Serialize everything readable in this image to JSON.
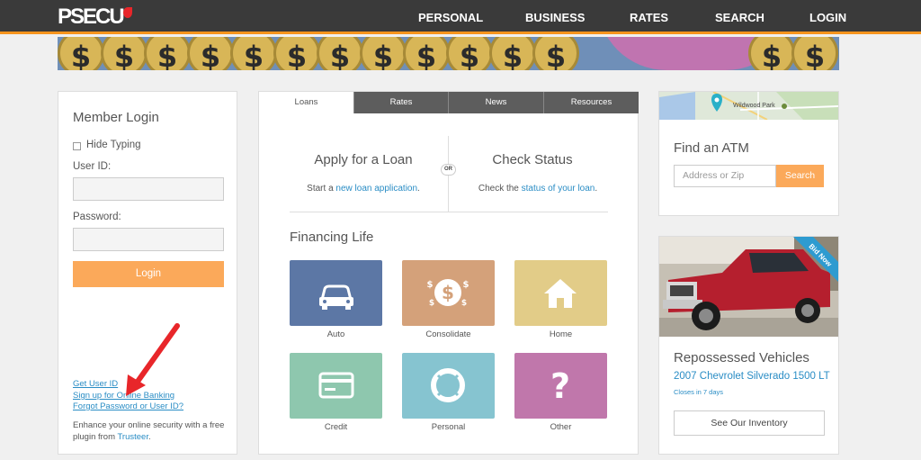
{
  "header": {
    "logo": "PSECU",
    "nav": [
      "PERSONAL",
      "BUSINESS",
      "RATES",
      "SEARCH",
      "LOGIN"
    ]
  },
  "login": {
    "title": "Member Login",
    "hide_typing": "Hide Typing",
    "user_id_label": "User ID:",
    "password_label": "Password:",
    "login_button": "Login",
    "links": [
      "Get User ID",
      "Sign up for Online Banking",
      "Forgot Password or User ID?"
    ],
    "enhance_text": "Enhance your online security with a free plugin from ",
    "trusteer": "Trusteer",
    "period": "."
  },
  "center": {
    "tabs": [
      "Loans",
      "Rates",
      "News",
      "Resources"
    ],
    "apply_title": "Apply for a Loan",
    "apply_sub_pre": "Start a ",
    "apply_sub_link": "new loan application",
    "apply_sub_post": ".",
    "or_label": "OR",
    "status_title": "Check Status",
    "status_sub_pre": "Check the ",
    "status_sub_link": "status of your loan",
    "status_sub_post": ".",
    "financing_title": "Financing Life",
    "tiles": [
      {
        "label": "Auto",
        "color": "#5c77a5"
      },
      {
        "label": "Consolidate",
        "color": "#d4a17a"
      },
      {
        "label": "Home",
        "color": "#e2cc88"
      },
      {
        "label": "Credit",
        "color": "#8ec7ae"
      },
      {
        "label": "Personal",
        "color": "#86c4d0"
      },
      {
        "label": "Other",
        "color": "#c077ab"
      }
    ]
  },
  "atm": {
    "map_label": "Wildwood Park",
    "title": "Find an ATM",
    "placeholder": "Address or Zip",
    "search_button": "Search"
  },
  "repo": {
    "ribbon": "Bid Now",
    "title": "Repossessed Vehicles",
    "vehicle": "2007 Chevrolet Silverado 1500 LT",
    "closes": "Closes in 7 days",
    "inventory_button": "See Our Inventory"
  },
  "colors": {
    "accent_orange": "#fba95a",
    "nav_bg": "#3a3a3a",
    "link_blue": "#2a8dc5"
  }
}
